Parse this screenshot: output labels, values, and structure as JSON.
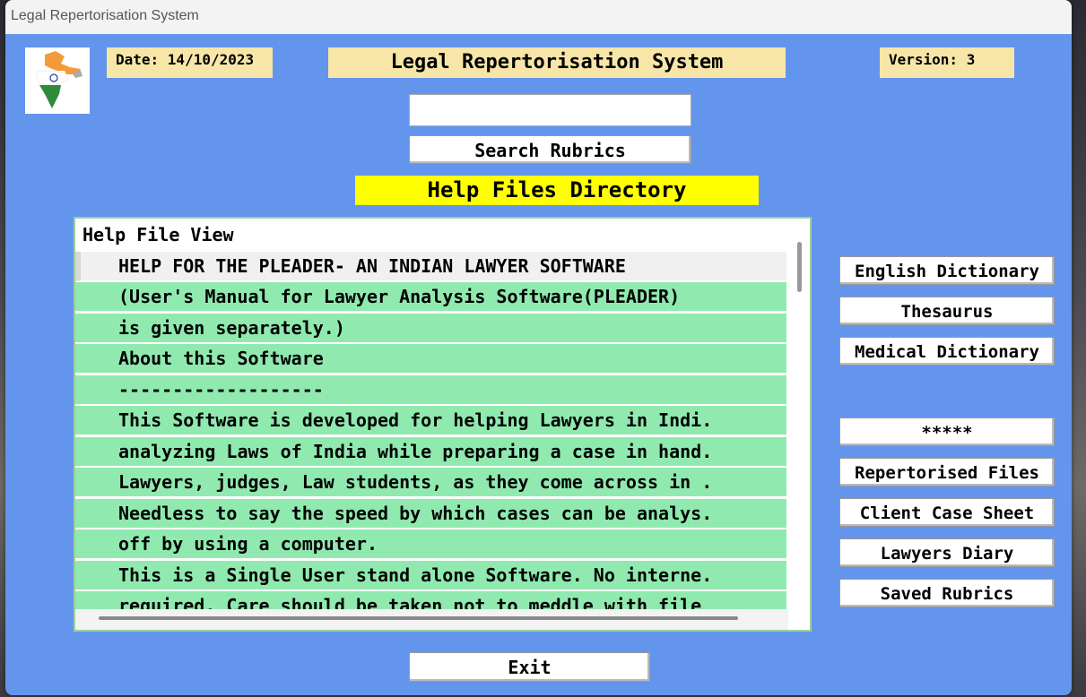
{
  "window": {
    "title": "Legal Repertorisation System"
  },
  "header": {
    "date": "Date: 14/10/2023",
    "app_title": "Legal Repertorisation System",
    "version": "Version: 3"
  },
  "search": {
    "value": "",
    "button_label": "Search Rubrics"
  },
  "help_dir_label": "Help Files Directory",
  "help_list": {
    "header": "Help File View",
    "rows": [
      "HELP FOR THE PLEADER- AN INDIAN LAWYER SOFTWARE",
      "(User's Manual  for Lawyer Analysis Software(PLEADER)",
      "is given separately.)",
      "About this Software",
      "-------------------",
      "This Software is developed for helping Lawyers in Indi.",
      "analyzing Laws of India while preparing a case in hand.",
      "Lawyers, judges, Law students, as they come across in .",
      "Needless to say the speed by which cases can be analys.",
      "off by using a computer.",
      "This is a Single User stand alone Software. No interne.",
      "required. Care should be taken not to meddle with file"
    ]
  },
  "side_buttons": {
    "english_dictionary": "English Dictionary",
    "thesaurus": "Thesaurus",
    "medical_dictionary": "Medical Dictionary",
    "stars": "*****",
    "repertorised_files": "Repertorised Files",
    "client_case_sheet": "Client Case Sheet",
    "lawyers_diary": "Lawyers Diary",
    "saved_rubrics": "Saved Rubrics"
  },
  "exit_label": "Exit",
  "icons": {
    "logo": "india-map-flag-icon"
  },
  "colors": {
    "background": "#6495ed",
    "label_bg": "#f7e6a8",
    "highlight": "#ffff00",
    "row_green": "#90eab0"
  }
}
